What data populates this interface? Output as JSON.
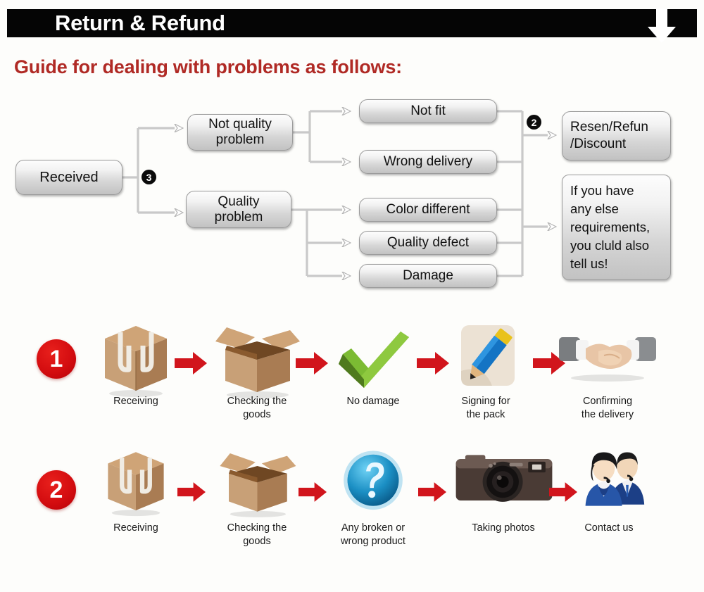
{
  "header": {
    "title": "Return & Refund",
    "arrow_icon": "down-arrow-icon",
    "subtitle": "Guide for dealing with problems as follows:"
  },
  "flowchart": {
    "start": {
      "label": "Received"
    },
    "branch_badge": "3",
    "categories": [
      {
        "label": "Not quality\nproblem"
      },
      {
        "label": "Quality\nproblem"
      }
    ],
    "issues": [
      {
        "label": "Not fit"
      },
      {
        "label": "Wrong delivery"
      },
      {
        "label": "Color different"
      },
      {
        "label": "Quality defect"
      },
      {
        "label": "Damage"
      }
    ],
    "merge_badge": "2",
    "outcomes": [
      {
        "label": "Resen/Refun\n/Discount"
      },
      {
        "label": "If you have\nany else\nrequirements,\nyou cluld also\ntell us!"
      }
    ]
  },
  "process_rows": [
    {
      "badge": "1",
      "steps": [
        {
          "icon": "sealed-box-icon",
          "caption": "Receiving"
        },
        {
          "icon": "open-box-icon",
          "caption": "Checking the\ngoods"
        },
        {
          "icon": "green-check-icon",
          "caption": "No damage"
        },
        {
          "icon": "pencil-signing-icon",
          "caption": "Signing for\nthe pack"
        },
        {
          "icon": "handshake-icon",
          "caption": "Confirming\nthe delivery"
        }
      ]
    },
    {
      "badge": "2",
      "steps": [
        {
          "icon": "sealed-box-icon",
          "caption": "Receiving"
        },
        {
          "icon": "open-box-icon",
          "caption": "Checking the\ngoods"
        },
        {
          "icon": "question-mark-icon",
          "caption": "Any broken or\nwrong product"
        },
        {
          "icon": "camera-icon",
          "caption": "Taking photos"
        },
        {
          "icon": "support-agents-icon",
          "caption": "Contact us"
        }
      ]
    }
  ],
  "colors": {
    "header_bar": "#050505",
    "subtitle_red": "#b02a25",
    "arrow_red": "#d1151c",
    "badge_black": "#0b0b0b",
    "node_border": "#9b9b9b"
  }
}
